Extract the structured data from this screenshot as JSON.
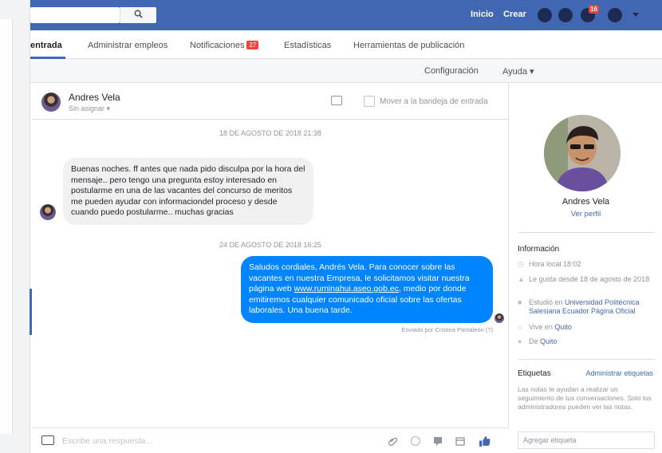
{
  "colors": {
    "brand_blue": "#4267b2",
    "bubble_sent": "#0084ff",
    "bubble_received": "#f1f0f0",
    "badge_red": "#fa3e3e"
  },
  "topbar": {
    "search_icon": "search-icon",
    "search_glyph": "🔍",
    "links": [
      "Inicio",
      "Crear"
    ],
    "notifications_badge": "16",
    "icons": [
      "friends-icon",
      "messenger-icon",
      "notifications-icon",
      "help-icon",
      "chevron-down-icon"
    ]
  },
  "tabs": {
    "items": [
      "entrada",
      "Administrar empleos",
      "Notificaciones",
      "Estadísticas",
      "Herramientas de publicación"
    ],
    "notifications_badge": "27"
  },
  "subnav": {
    "config": "Configuración",
    "help": "Ayuda ▾"
  },
  "conversation": {
    "name": "Andres Vela",
    "assigned": "Sin asignar ▾",
    "move_to_inbox": "Mover a la bandeja de entrada",
    "date1": "18 DE AGOSTO DE 2018 21:38",
    "message_in": "Buenas noches. ff antes que nada pido disculpa por la hora del mensaje.. pero tengo una pregunta estoy interesado en postularme en una de las vacantes del concurso de meritos me pueden ayudar con informaciondel proceso y desde cuando puedo postularme.. muchas gracias",
    "date2": "24 DE AGOSTO DE 2018 16:25",
    "message_out_1": "Saludos cordiales, Andrés Vela. Para conocer sobre las vacantes en nuestra Empresa, le solicitamos visitar nuestra página web ",
    "message_out_link": "www.ruminahui.aseo.gob.ec",
    "message_out_2": ", medio por donde emitiremos cualquier comunicado oficial sobre las ofertas laborales. Una buena tarde.",
    "sent_by": "Enviado por Cristina Pantaleón (?)",
    "composer_placeholder": "Escribe una respuesta...",
    "composer_icons": [
      "attachment-icon",
      "emoji-icon",
      "saved-reply-icon",
      "calendar-icon",
      "like-icon"
    ]
  },
  "profile": {
    "name": "Andres Vela",
    "view_profile": "Ver perfil",
    "info_title": "Información",
    "info": [
      {
        "icon": "clock-icon",
        "glyph": "◷",
        "text": "Hora local 18:02",
        "highlight": ""
      },
      {
        "icon": "like-icon",
        "glyph": "👍",
        "text": "Le gusta desde 18 de agosto de 2018",
        "highlight": ""
      },
      {
        "icon": "education-icon",
        "glyph": "🎓",
        "text": "Estudió en ",
        "highlight": "Universidad Politécnica Salesiana Ecuador Página Oficial"
      },
      {
        "icon": "home-icon",
        "glyph": "⌂",
        "text": "Vive en ",
        "highlight": "Quito"
      },
      {
        "icon": "location-icon",
        "glyph": "◉",
        "text": "De ",
        "highlight": "Quito"
      }
    ],
    "tags_title": "Etiquetas",
    "tags_manage": "Administrar etiquetas",
    "tags_note": "Las notas te ayudan a realizar un seguimiento de tus conversaciones. Solo los administradores pueden ver las notas.",
    "tag_placeholder": "Agregar etiqueta"
  }
}
